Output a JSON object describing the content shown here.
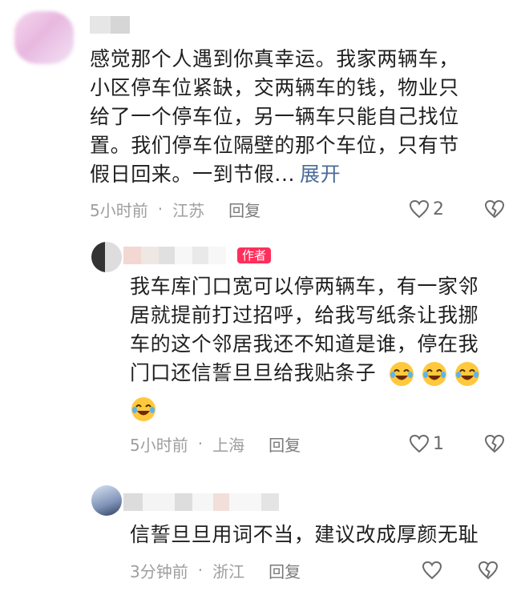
{
  "comments": [
    {
      "text": "感觉那个人遇到你真幸运。我家两辆车，\n小区停车位紧缺，交两辆车的钱，物业只\n给了一个停车位，另一辆车只能自己找位\n置。我们停车位隔壁的那个车位，只有节\n假日回来。一到节假...",
      "expand": "展开",
      "time": "5小时前",
      "location": "江苏",
      "reply": "回复",
      "likes": "2"
    },
    {
      "tag": "作者",
      "text": "我车库门口宽可以停两辆车，有一家邻\n居就提前打过招呼，给我写纸条让我挪\n车的这个邻居我还不知道是谁，停在我\n门口还信誓旦旦给我贴条子",
      "emoji": "laughing-crying-emoji",
      "time": "5小时前",
      "location": "上海",
      "reply": "回复",
      "likes": "1"
    },
    {
      "text": "信誓旦旦用词不当，建议改成厚颜无耻",
      "time": "3分钟前",
      "location": "浙江",
      "reply": "回复"
    }
  ],
  "colors": {
    "author_tag": "#ff2e5b",
    "meta_text": "#9e9e9e",
    "expand": "#4a6b9a"
  }
}
